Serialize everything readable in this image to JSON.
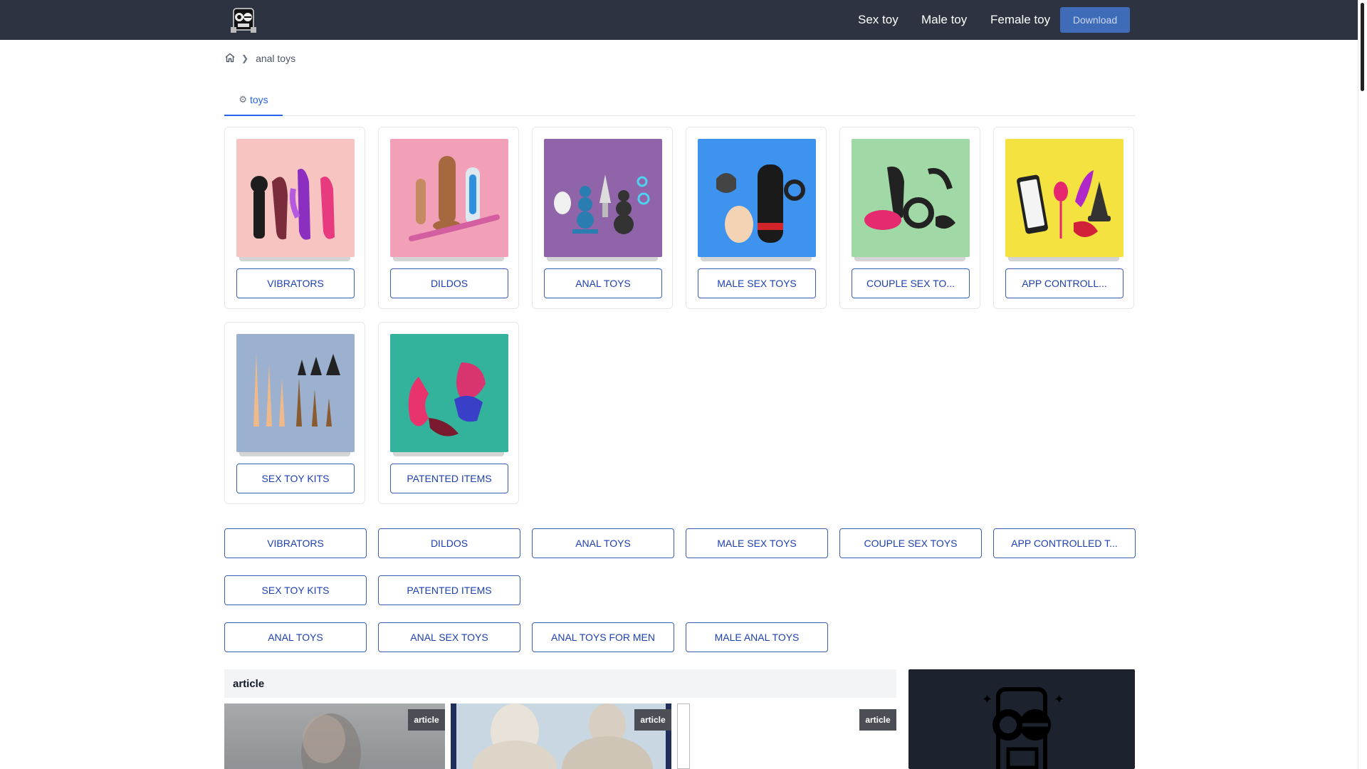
{
  "header": {
    "logo_icon": "robot-mascot-icon",
    "nav": [
      "Sex toy",
      "Male toy",
      "Female toy"
    ],
    "download_label": "Download"
  },
  "breadcrumb": {
    "home_icon": "home-icon",
    "current": "anal toys"
  },
  "tab": {
    "icon": "toy-icon",
    "label": "toys"
  },
  "categories": [
    {
      "label": "VIBRATORS",
      "bg": "#f7c4c2"
    },
    {
      "label": "DILDOS",
      "bg": "#f2a0b8"
    },
    {
      "label": "ANAL TOYS",
      "bg": "#8f64a8"
    },
    {
      "label": "MALE SEX TOYS",
      "bg": "#3e93ef"
    },
    {
      "label": "COUPLE SEX TO...",
      "bg": "#a0d8a6"
    },
    {
      "label": "APP CONTROLL...",
      "bg": "#f3e240"
    },
    {
      "label": "SEX TOY KITS",
      "bg": "#9bb1cf"
    },
    {
      "label": "PATENTED ITEMS",
      "bg": "#34b39c"
    }
  ],
  "tag_rows": [
    [
      "VIBRATORS",
      "DILDOS",
      "ANAL TOYS",
      "MALE SEX TOYS",
      "COUPLE SEX TOYS",
      "APP CONTROLLED T..."
    ],
    [
      "SEX TOY KITS",
      "PATENTED ITEMS"
    ],
    [
      "ANAL TOYS",
      "ANAL SEX TOYS",
      "ANAL TOYS FOR MEN",
      "MALE ANAL TOYS"
    ]
  ],
  "articles": {
    "heading": "article",
    "badges": [
      "article",
      "article",
      "article"
    ]
  }
}
